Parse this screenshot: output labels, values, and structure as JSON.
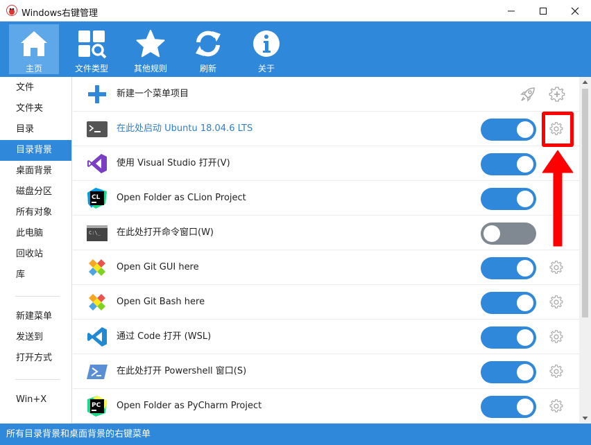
{
  "window": {
    "title": "Windows右键管理"
  },
  "toolbar": {
    "items": [
      {
        "label": "主页",
        "icon": "home-icon"
      },
      {
        "label": "文件类型",
        "icon": "file-types-icon"
      },
      {
        "label": "其他规则",
        "icon": "star-icon"
      },
      {
        "label": "刷新",
        "icon": "refresh-icon"
      },
      {
        "label": "关于",
        "icon": "info-icon"
      }
    ],
    "active": "主页",
    "accent": "#2f88d9"
  },
  "sidebar": {
    "items": [
      {
        "label": "文件"
      },
      {
        "label": "文件夹"
      },
      {
        "label": "目录"
      },
      {
        "label": "目录背景"
      },
      {
        "label": "桌面背景"
      },
      {
        "label": "磁盘分区"
      },
      {
        "label": "所有对象"
      },
      {
        "label": "此电脑"
      },
      {
        "label": "回收站"
      },
      {
        "label": "库"
      },
      {
        "label": "新建菜单"
      },
      {
        "label": "发送到"
      },
      {
        "label": "打开方式"
      },
      {
        "label": "Win+X"
      }
    ],
    "active": "目录背景"
  },
  "main": {
    "new_item": {
      "label": "新建一个菜单项目"
    },
    "rows": [
      {
        "label": "在此处启动 Ubuntu 18.04.6 LTS",
        "icon": "terminal-icon",
        "enabled": true
      },
      {
        "label": "使用 Visual Studio 打开(V)",
        "icon": "visual-studio-icon",
        "enabled": true
      },
      {
        "label": "Open Folder as CLion Project",
        "icon": "clion-icon",
        "enabled": true
      },
      {
        "label": "在此处打开命令窗口(W)",
        "icon": "cmd-icon",
        "enabled": false
      },
      {
        "label": "Open Git GUI here",
        "icon": "git-icon",
        "enabled": true
      },
      {
        "label": "Open Git Bash here",
        "icon": "git-icon",
        "enabled": true
      },
      {
        "label": "通过 Code 打开 (WSL)",
        "icon": "vscode-icon",
        "enabled": true
      },
      {
        "label": "在此处打开 Powershell 窗口(S)",
        "icon": "powershell-icon",
        "enabled": true
      },
      {
        "label": "Open Folder as PyCharm Project",
        "icon": "pycharm-icon",
        "enabled": true
      }
    ]
  },
  "status": {
    "text": "所有目录背景和桌面背景的右键菜单"
  },
  "annotation": {
    "color": "#ff0000"
  }
}
